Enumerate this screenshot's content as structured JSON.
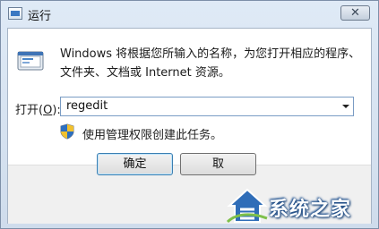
{
  "window": {
    "title": "运行",
    "close_glyph": "✕"
  },
  "dialog": {
    "description": "Windows 将根据您所输入的名称，为您打开相应的程序、文件夹、文档或 Internet 资源。",
    "open_label_prefix": "打开(",
    "open_label_mnemonic": "O",
    "open_label_suffix": "):",
    "command_value": "regedit",
    "admin_note": "使用管理权限创建此任务。"
  },
  "buttons": {
    "ok": "确定",
    "cancel": "取"
  },
  "watermark": {
    "text": "系统之家"
  },
  "icons": {
    "app": "run-app-icon",
    "run": "run-program-icon",
    "shield": "uac-shield-icon",
    "house": "house-logo-icon"
  }
}
